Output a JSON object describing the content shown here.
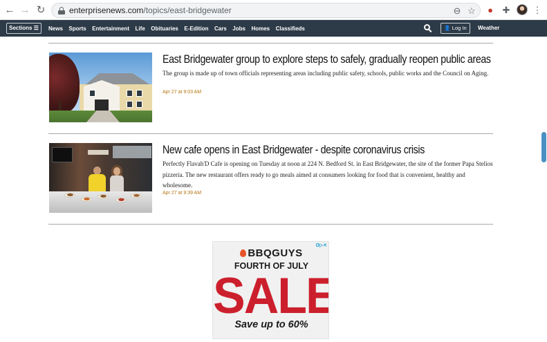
{
  "browser": {
    "url_host": "enterprisenews.com",
    "url_path": "/topics/east-bridgewater",
    "back_icon": "←",
    "forward_icon": "→",
    "reload_icon": "↻",
    "zoom_icon": "⊖",
    "star_icon": "☆",
    "puzzle_icon": "✚",
    "menu_icon": "⋮"
  },
  "site_nav": {
    "sections_label": "Sections ☰",
    "items": [
      "News",
      "Sports",
      "Entertainment",
      "Life",
      "Obituaries",
      "E-Edition",
      "Cars",
      "Jobs",
      "Homes",
      "Classifieds"
    ],
    "login_label": "👤 Log In",
    "weather_label": "Weather"
  },
  "articles": [
    {
      "headline": "East Bridgewater group to explore steps to safely, gradually reopen public areas",
      "summary": "The group is made up of town officials representing areas including public safety, schools, public works and the Council on Aging.",
      "timestamp": "Apr 27 at 9:03 AM"
    },
    {
      "headline": "New cafe opens in East Bridgewater - despite coronavirus crisis",
      "summary": "Perfectly Flavah'D Cafe is opening on Tuesday at noon at 224 N. Bedford St. in East Bridgewater, the site of the former Papa Stelios pizzeria. The new restaurant offers ready to go meals aimed at consumers looking for food that is convenient, healthy and wholesome.",
      "timestamp": "Apr 27 at 9:39 AM"
    }
  ],
  "ad": {
    "choices_label": "D▷✕",
    "brand": "BBQGUYS",
    "line1": "FOURTH OF JULY",
    "headline": "SALE!",
    "line2": "Save up to 60%"
  },
  "colors": {
    "nav_bg": "#2d3a47",
    "timestamp": "#b4740e",
    "sale_red": "#cc1f2d",
    "scrollbar": "#4a90c2"
  }
}
